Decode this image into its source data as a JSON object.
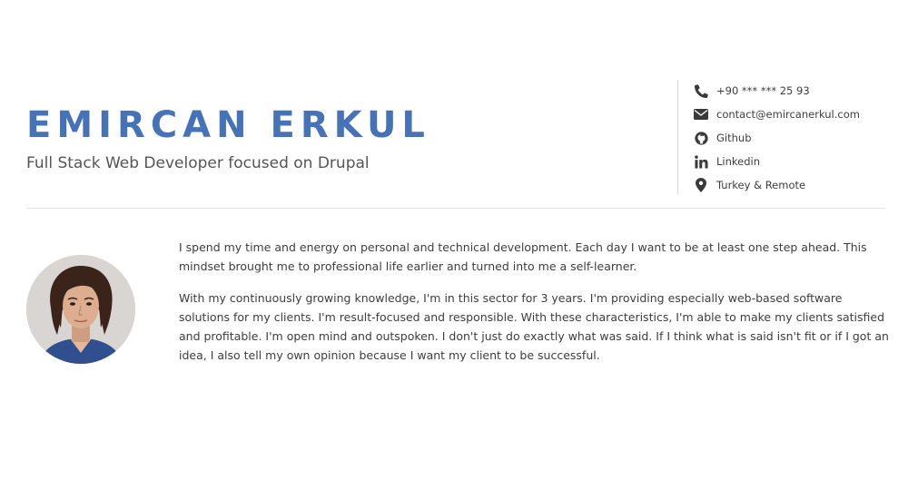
{
  "profile": {
    "name": "EMIRCAN ERKUL",
    "tagline": "Full Stack Web Developer focused on Drupal"
  },
  "contact": {
    "items": [
      {
        "icon": "phone-icon",
        "label": "+90 *** *** 25 93"
      },
      {
        "icon": "envelope-icon",
        "label": "contact@emircanerkul.com"
      },
      {
        "icon": "github-icon",
        "label": "Github"
      },
      {
        "icon": "linkedin-icon",
        "label": "Linkedin"
      },
      {
        "icon": "map-marker-icon",
        "label": "Turkey & Remote"
      }
    ]
  },
  "about": {
    "paragraphs": [
      "I spend my time and energy on personal and technical development. Each day I want to be at least one step ahead. This mindset brought me to professional life earlier and turned into me a self-learner.",
      "With my continuously growing knowledge, I'm in this sector for 3 years. I'm providing especially web-based software solutions for my clients. I'm result-focused and responsible. With these characteristics, I'm able to make my clients satisfied and profitable. I'm open mind and outspoken. I don't just do exactly what was said. If I think what is said isn't fit or if I got an idea, I also tell my own opinion because I want my client to be successful."
    ]
  },
  "colors": {
    "accent": "#4672b8",
    "text": "#3d3d3d",
    "icon": "#3a3a3a"
  }
}
